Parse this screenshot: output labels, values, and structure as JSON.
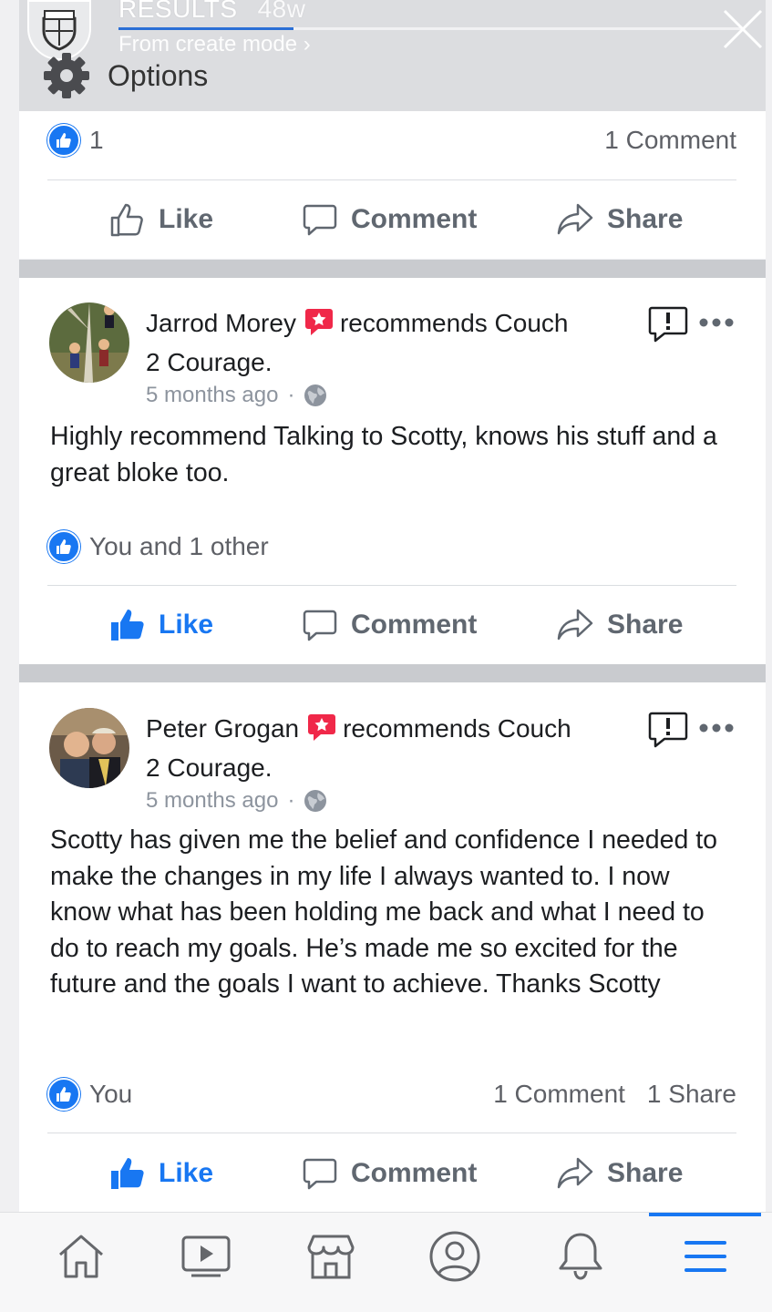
{
  "story_overlay": {
    "title": "RESULTS",
    "age": "48w",
    "subtitle": "From create mode ›",
    "progress": 0.28
  },
  "options": {
    "label": "Options"
  },
  "top_post": {
    "like_count": "1",
    "comment_count": "1 Comment"
  },
  "actions": {
    "like": "Like",
    "comment": "Comment",
    "share": "Share"
  },
  "posts": [
    {
      "author": "Jarrod Morey",
      "recommends": "recommends Couch",
      "page": "2 Courage.",
      "time": "5 months ago",
      "dot": "·",
      "body": "Highly recommend Talking to Scotty, knows his stuff and a great bloke too.",
      "reactions": "You and 1 other",
      "liked": true
    },
    {
      "author": "Peter Grogan",
      "recommends": "recommends Couch",
      "page": "2 Courage.",
      "time": "5 months ago",
      "dot": "·",
      "body": "Scotty has given me the belief and confidence I needed to make the changes in my life I always wanted to. I now know what has been holding me back and what I need to do to reach my goals. He’s made me so excited for the future and the goals I want to achieve. Thanks Scotty",
      "reactions": "You",
      "comment_count": "1 Comment",
      "share_count": "1 Share",
      "liked": true
    }
  ],
  "bottom_nav": {
    "items": [
      "home-icon",
      "watch-icon",
      "marketplace-icon",
      "profile-icon",
      "notifications-icon",
      "menu-icon"
    ],
    "active": "menu-icon"
  },
  "colors": {
    "facebook_blue": "#1877f2",
    "recommend_red": "#f02849"
  }
}
